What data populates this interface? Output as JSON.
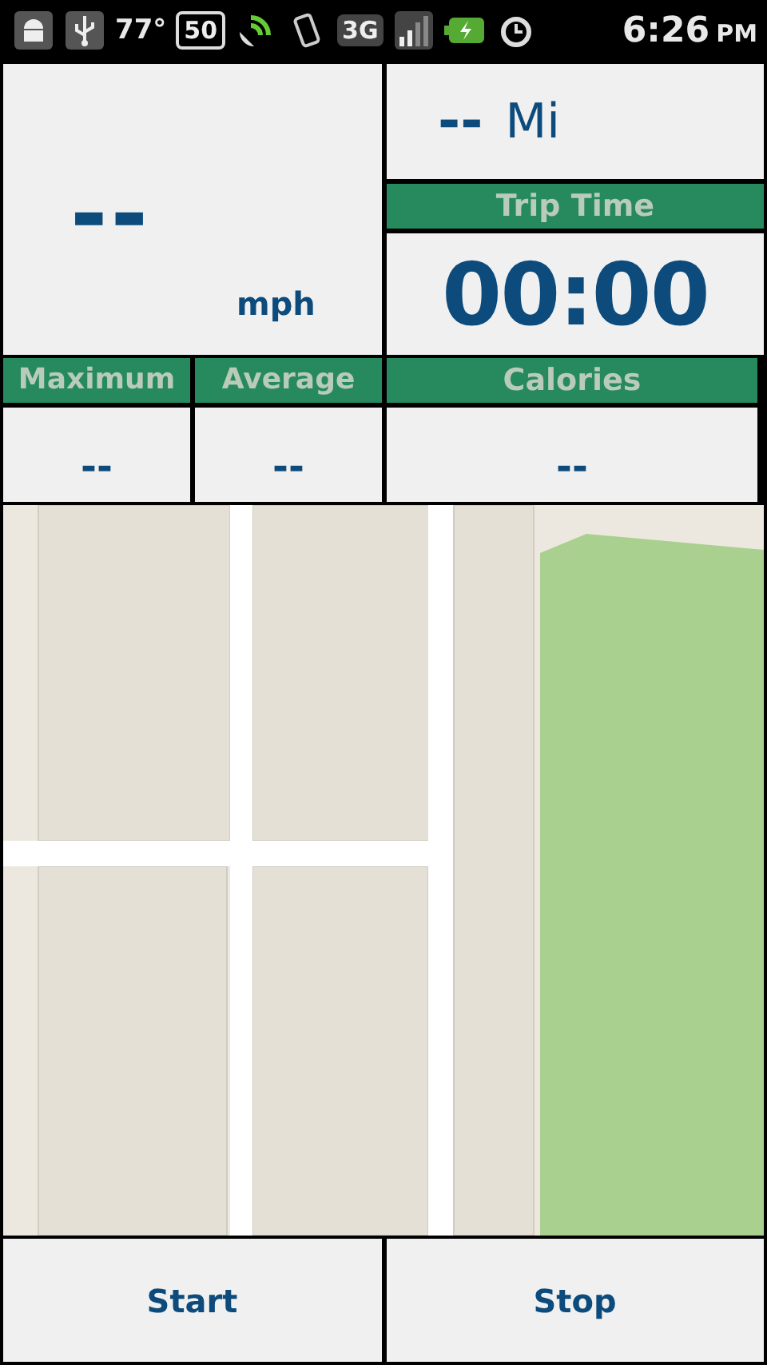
{
  "status_bar": {
    "temperature": "77°",
    "battery_saver": "50",
    "network": "3G",
    "time": "6:26",
    "meridiem": "PM"
  },
  "speed": {
    "value": "--",
    "unit": "mph"
  },
  "distance": {
    "value": "--",
    "unit": "Mi"
  },
  "trip_time": {
    "label": "Trip Time",
    "value": "00:00"
  },
  "stats": [
    {
      "label": "Maximum",
      "value": "--"
    },
    {
      "label": "Average",
      "value": "--"
    },
    {
      "label": "Calories",
      "value": "--"
    }
  ],
  "buttons": [
    {
      "label": "Start"
    },
    {
      "label": "Stop"
    }
  ]
}
